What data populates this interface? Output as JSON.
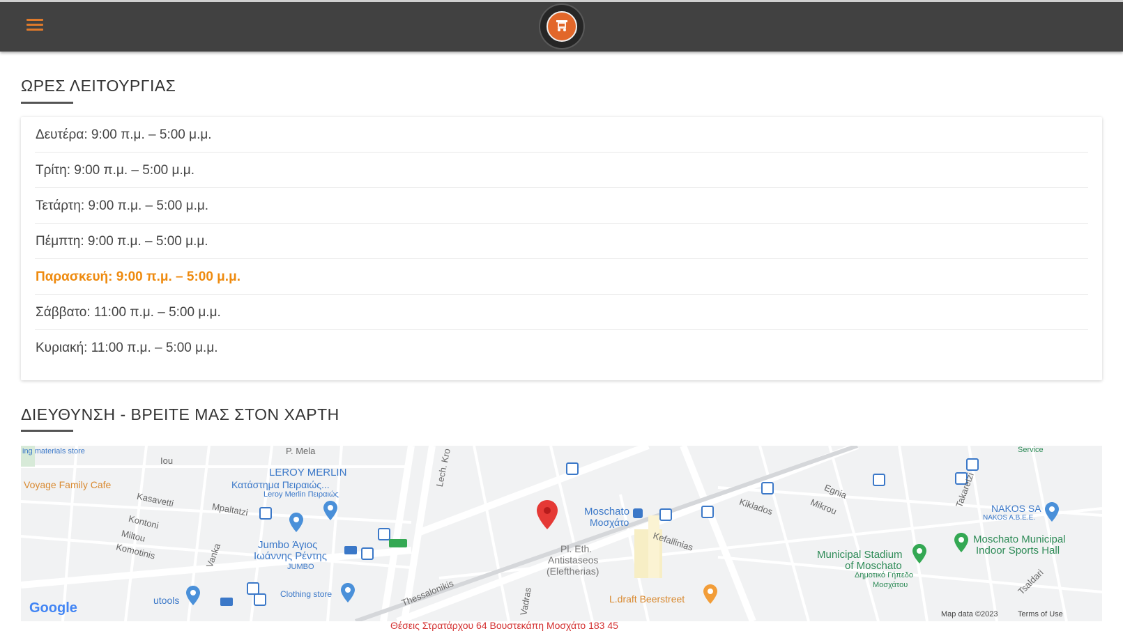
{
  "header": {
    "menu_icon": "hamburger-menu-icon",
    "logo_icon": "tow-truck-logo-icon",
    "accent_color": "#e07a2b",
    "bar_color": "#414141"
  },
  "hours_section": {
    "title": "ΩΡΕΣ ΛΕΙΤΟΥΡΓΙΑΣ",
    "rows": [
      "Δευτέρα: 9:00 π.μ. – 5:00 μ.μ.",
      "Τρίτη: 9:00 π.μ. – 5:00 μ.μ.",
      "Τετάρτη: 9:00 π.μ. – 5:00 μ.μ.",
      "Πέμπτη: 9:00 π.μ. – 5:00 μ.μ.",
      "Παρασκευή: 9:00 π.μ. – 5:00 μ.μ.",
      "Σάββατο: 11:00 π.μ. – 5:00 μ.μ.",
      "Κυριακή: 11:00 π.μ. – 5:00 μ.μ."
    ],
    "highlight_color": "#ee8a0e"
  },
  "address_section": {
    "title": "ΔΙΕΥΘΥΝΣΗ - ΒΡΕΙΤΕ ΜΑΣ ΣΤΟΝ ΧΑΡΤΗ"
  },
  "map": {
    "labels": {
      "materials": "ing materials store",
      "voyage": "Voyage Family Cafe",
      "leroy1": "LEROY MERLIN",
      "leroy2": "Κατάστημα Πειραιώς...",
      "leroy3": "Leroy Merlin Πειραιώς",
      "jumbo1": "Jumbo Άγιος",
      "jumbo2": "Ιωάννης Ρέντης",
      "jumbo3": "JUMBO",
      "utools": "utools",
      "clothing": "Clothing store",
      "moschato1": "Moschato",
      "moschato2": "Μοσχάτο",
      "pl1": "Pl. Eth.",
      "pl2": "Antistaseos",
      "pl3": "(Eleftherias)",
      "ldraft": "L.draft Beerstreet",
      "stadium1": "Municipal Stadium",
      "stadium2": "of Moschato",
      "stadium3": "Δημοτικό Γήπεδο",
      "stadium4": "Μοσχάτου",
      "nakos1": "NAKOS SA",
      "nakos2": "NAKOS A.B.E.E.",
      "moschatoMunicipal1": "Moschato Municipal",
      "moschatoMunicipal2": "Indoor Sports Hall",
      "street_mela": "P. Mela",
      "street_iou": "Iou",
      "street_kassaveti": "Kasavetti",
      "street_mpaltatzi": "Mpaltatzi",
      "street_kontoni": "Kontoni",
      "street_miltou": "Miltou",
      "street_komotinis": "Komotinis",
      "street_vanka": "Vanka",
      "street_thessalonikis": "Thessalonikis",
      "street_kefallinias": "Kefallinias",
      "street_kiklados": "Kiklados",
      "street_egnia": "Egnia",
      "street_mikrou": "Mikrou",
      "street_takaretzi": "Takaretzi",
      "street_lech": "Lech. Kro",
      "street_tsaldari": "Tsaldari",
      "street_vadras": "Vadras",
      "google": "Google",
      "map_data": "Map data ©2023",
      "terms": "Terms of Use",
      "service": "Service"
    }
  },
  "footer": {
    "address_partial": "Θέσεις Στρατάρχου 64 Βουστεκάπη Μοσχάτο 183 45"
  }
}
